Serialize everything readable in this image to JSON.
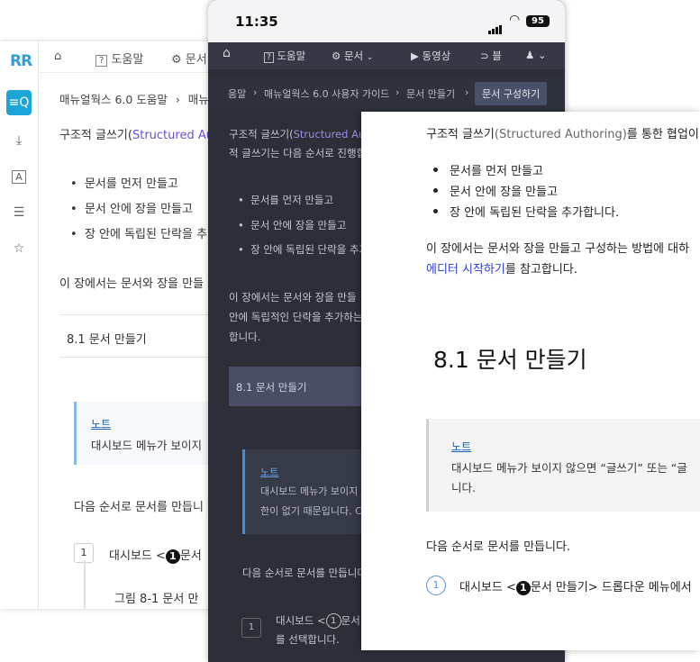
{
  "desktop": {
    "logo": "RR",
    "rail_icons": [
      "search-list-icon",
      "download-icon",
      "font-icon",
      "menu-icon",
      "star-icon"
    ],
    "topbar": {
      "home": "⌂",
      "help_icon": "?",
      "help_label": "도움말",
      "docs_label": "문서"
    },
    "breadcrumb": [
      "매뉴얼웍스 6.0 도움말",
      "매뉴"
    ],
    "intro_prefix": "구조적 글쓰기(",
    "intro_link": "Structured Auth",
    "bullets": [
      "문서를 먼저 만들고",
      "문서 안에 장을 만들고",
      "장 안에 독립된 단락을 추"
    ],
    "chapter_text": "이 장에서는 문서와 장을 만들",
    "section": "8.1  문서 만들기",
    "note_title": "노트",
    "note_body": "대시보드 메뉴가 보이지",
    "steps_intro": "다음 순서로 문서를 만듭니",
    "step_num": "1",
    "step_prefix": "대시보드 <",
    "step_badge": "1",
    "step_after": "문서",
    "figure": "그림 8-1  문서 만"
  },
  "mobile": {
    "time": "11:35",
    "battery": "95",
    "nav": {
      "home": "⌂",
      "help": "도움말",
      "docs": "문서",
      "video": "동영상",
      "rss": "블"
    },
    "breadcrumb": [
      "움말",
      "매뉴얼웍스 6.0 사용자 가이드",
      "문서 만들기"
    ],
    "breadcrumb_current": "문서 구성하기",
    "intro_prefix": "구조적 글쓰기(",
    "intro_link": "Structured Au",
    "intro_line2": "적 글쓰기는 다음 순서로 진행합",
    "bullets": [
      "문서를 먼저 만들고",
      "문서 안에 장을 만들고",
      "장 안에 독립된 단락을 추가"
    ],
    "chapter_line1": "이 장에서는 문서와 장을 만들",
    "chapter_line2": "안에 독립적인 단락을 추가하는",
    "chapter_line3": "합니다.",
    "section": "8.1  문서 만들기",
    "note_title": "노트",
    "note_body": "대시보드 메뉴가 보이지",
    "note_body2": "한이 없기 때문입니다. C",
    "steps_intro": "다음 순서로 문서를 만듭니다",
    "step_num": "1",
    "step_prefix": "대시보드 <",
    "step_badge": "1",
    "step_after": "문서",
    "step_line2": "를 선택합니다."
  },
  "doc": {
    "intro_prefix": "구조적 글쓰기",
    "intro_paren": "(Structured Authoring)",
    "intro_suffix": "를 통한 협업이",
    "bullets": [
      "문서를 먼저 만들고",
      "문서 안에 장을 만들고",
      "장 안에 독립된 단락을 추가합니다."
    ],
    "chapter_line1": "이 장에서는 문서와 장을 만들고 구성하는 방법에 대하",
    "chapter_link": "에디터 시작하기",
    "chapter_line2_suffix": "를 참고합니다.",
    "heading": "8.1  문서 만들기",
    "note_title": "노트",
    "note_body": "대시보드 메뉴가 보이지 않으면 “글쓰기” 또는 “글",
    "note_body2": "니다.",
    "steps_intro": "다음 순서로 문서를 만듭니다.",
    "step_num": "1",
    "step_prefix": "대시보드 <",
    "step_badge": "1",
    "step_after": "문서 만들기> 드롭다운 메뉴에서"
  }
}
